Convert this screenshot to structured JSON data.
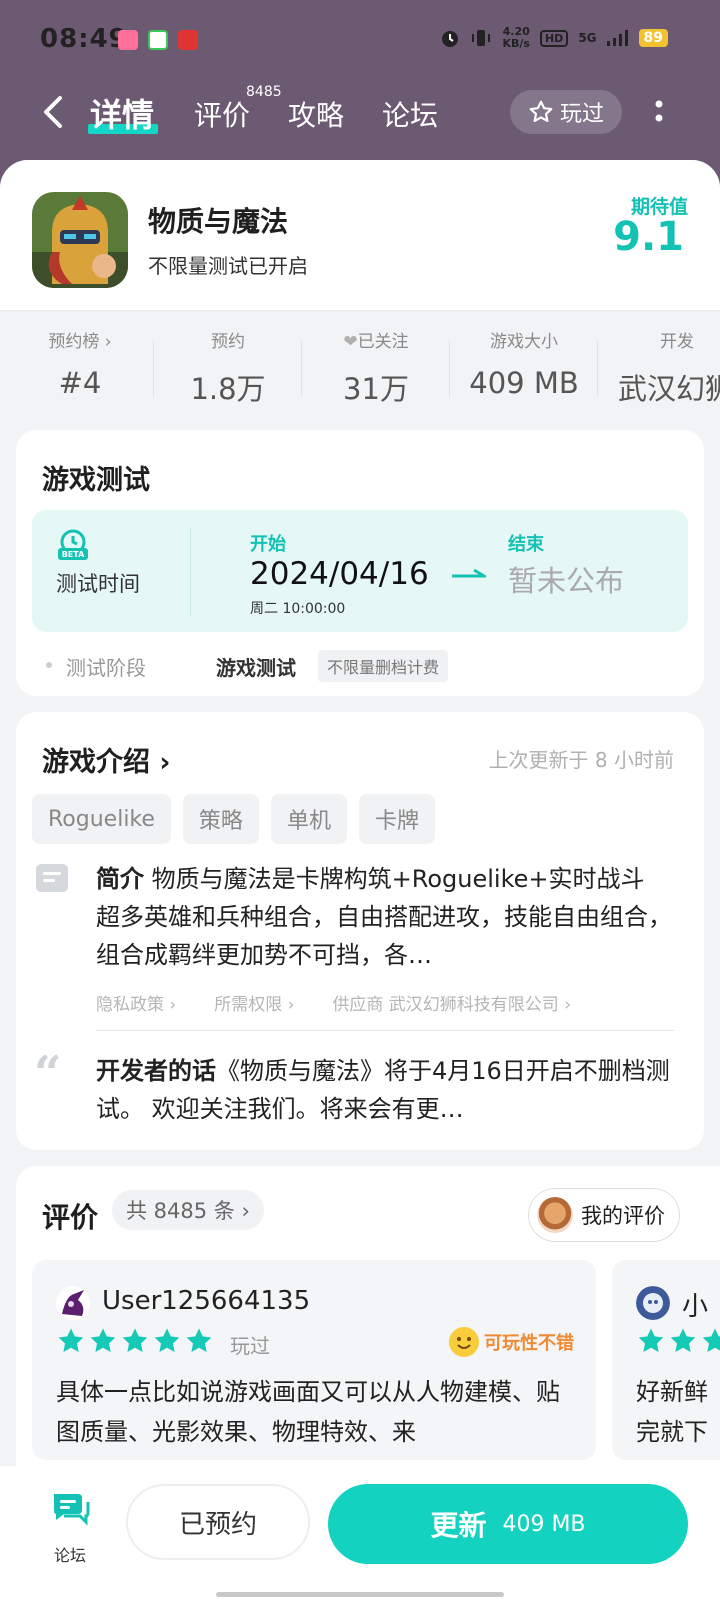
{
  "status": {
    "time": "08:49",
    "speed_value": "4.20",
    "speed_unit": "KB/s",
    "hd": "HD",
    "net": "5G",
    "battery": "89"
  },
  "nav": {
    "tabs": [
      "详情",
      "评价",
      "攻略",
      "论坛"
    ],
    "review_badge": "8485",
    "played_label": "玩过"
  },
  "app": {
    "name": "物质与魔法",
    "subtitle": "不限量测试已开启",
    "expect_label": "期待值",
    "expect_value": "9.1"
  },
  "stats": [
    {
      "label": "预约榜 ›",
      "value": "#4"
    },
    {
      "label": "预约",
      "value": "1.8万"
    },
    {
      "label": "已关注",
      "value": "31万"
    },
    {
      "label": "游戏大小",
      "value": "409 MB"
    },
    {
      "label": "开发",
      "value": "武汉幻狮"
    }
  ],
  "test": {
    "title": "游戏测试",
    "time_label": "测试时间",
    "start_label": "开始",
    "start_date": "2024/04/16",
    "start_time": "周二  10:00:00",
    "end_label": "结束",
    "end_value": "暂未公布",
    "phase_label": "测试阶段",
    "phase_value": "游戏测试",
    "phase_tag": "不限量删档计费"
  },
  "intro": {
    "title": "游戏介绍 ›",
    "updated": "上次更新于 8 小时前",
    "tags": [
      "Roguelike",
      "策略",
      "单机",
      "卡牌"
    ],
    "brief_prefix": "简介",
    "brief_text": " 物质与魔法是卡牌构筑+Roguelike+实时战斗 超多英雄和兵种组合，自由搭配进攻，技能自由组合，组合成羁绊更加势不可挡，各…",
    "links": [
      "隐私政策 ›",
      "所需权限 ›",
      "供应商 武汉幻狮科技有限公司 ›"
    ],
    "dev_prefix": "开发者的话",
    "dev_text": "《物质与魔法》将于4月16日开启不删档测试。 欢迎关注我们。将来会有更…"
  },
  "reviews": {
    "title": "评价",
    "count": "共 8485 条 ›",
    "my_review": "我的评价",
    "items": [
      {
        "user": "User125664135",
        "played": "玩过",
        "tag": "可玩性不错",
        "text": "具体一点比如说游戏画面又可以从人物建模、贴图质量、光影效果、物理特效、来"
      },
      {
        "user": "小",
        "text": "好新鲜完就下"
      }
    ]
  },
  "bottom": {
    "forum_label": "论坛",
    "booked_label": "已预约",
    "update_label": "更新",
    "update_size": "409 MB"
  },
  "colors": {
    "accent": "#14d2c0",
    "header_bg": "#6b5a72",
    "star": "#14c9b6",
    "rating_tag": "#f08a33"
  }
}
